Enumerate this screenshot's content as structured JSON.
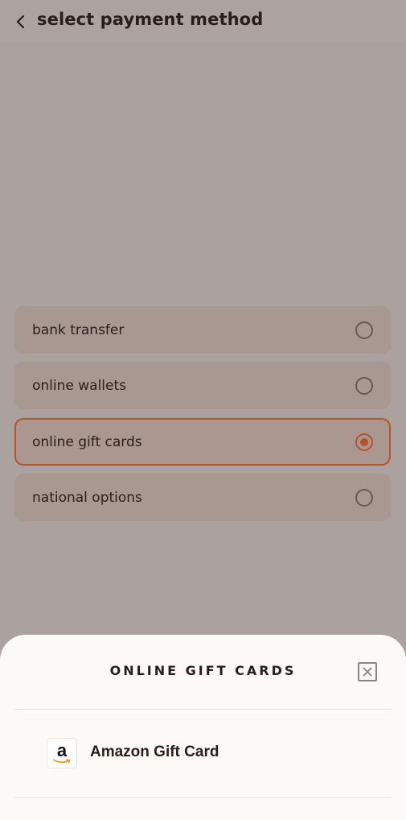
{
  "header": {
    "title": "select payment method"
  },
  "payment_options": [
    {
      "label": "bank transfer",
      "selected": false
    },
    {
      "label": "online wallets",
      "selected": false
    },
    {
      "label": "online gift cards",
      "selected": true
    },
    {
      "label": "national options",
      "selected": false
    }
  ],
  "sheet": {
    "title": "ONLINE GIFT CARDS",
    "items": [
      {
        "label": "Amazon Gift Card",
        "logo_letter": "a",
        "icon": "amazon-logo-icon"
      }
    ]
  },
  "colors": {
    "accent": "#b5532b",
    "overlay_background": "#aba19e",
    "option_background": "#a99891",
    "sheet_background": "#fdf9f6",
    "text": "#2b1d1a"
  }
}
